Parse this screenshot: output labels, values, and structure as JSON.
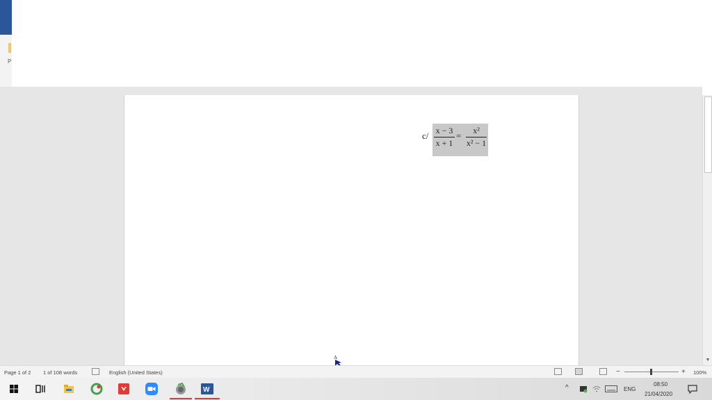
{
  "ribbon": {
    "letter": "P"
  },
  "equation": {
    "label": "c/",
    "left_num": "x − 3",
    "left_den": "x + 1",
    "equals": "=",
    "right_num": "x²",
    "right_den": "x² − 1"
  },
  "cursor_letter": "A",
  "status": {
    "page": "Page 1 of 2",
    "words": "1 of 108 words",
    "language": "English (United States)",
    "zoom_minus": "−",
    "zoom_plus": "+",
    "zoom": "100%"
  },
  "tray": {
    "lang": "ENG",
    "time": "08:50",
    "date": "21/04/2020",
    "chevron": "^"
  },
  "colors": {
    "word_blue": "#2b579a",
    "taskbar_underline": "#e53935"
  }
}
